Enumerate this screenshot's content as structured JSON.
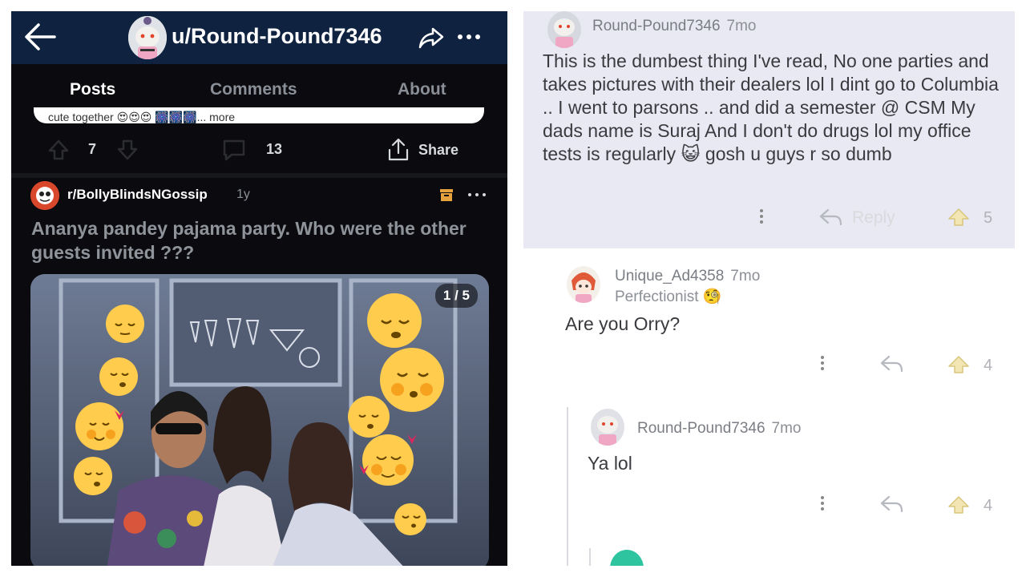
{
  "left": {
    "topbar": {
      "username": "u/Round-Pound7346"
    },
    "tabs": {
      "posts": "Posts",
      "comments": "Comments",
      "about": "About"
    },
    "prev_post": {
      "snippet": "cute together 😍😍😍 🎆🎆🎆... more",
      "upvotes": "7",
      "comments": "13",
      "share_label": "Share"
    },
    "post": {
      "subreddit": "r/BollyBlindsNGossip",
      "age": "1y",
      "title": "Ananya pandey pajama party. Who were the other guests invited ???",
      "pager": "1 / 5"
    }
  },
  "right": {
    "comments": [
      {
        "user": "Round-Pound7346",
        "age": "7mo",
        "body": "This is the dumbest thing I've read, No one parties and takes pictures with their dealers lol I dint go to Columbia .. I went to parsons .. and did a semester @ CSM My dads name is Suraj And I don't do drugs lol my office tests is regularly 😺 gosh u guys r so dumb",
        "reply_label": "Reply",
        "votes": "5"
      },
      {
        "user": "Unique_Ad4358",
        "age": "7mo",
        "flair": "Perfectionist 🧐",
        "body": "Are you Orry?",
        "votes": "4"
      },
      {
        "user": "Round-Pound7346",
        "age": "7mo",
        "body": "Ya lol",
        "votes": "4"
      }
    ]
  },
  "colors": {
    "nav_bg": "#0f2340",
    "dark_bg": "#0b0b0f",
    "accent_blue": "#2e7bd8",
    "subreddit_red": "#d9472b",
    "highlight": "#e8e9f3"
  }
}
